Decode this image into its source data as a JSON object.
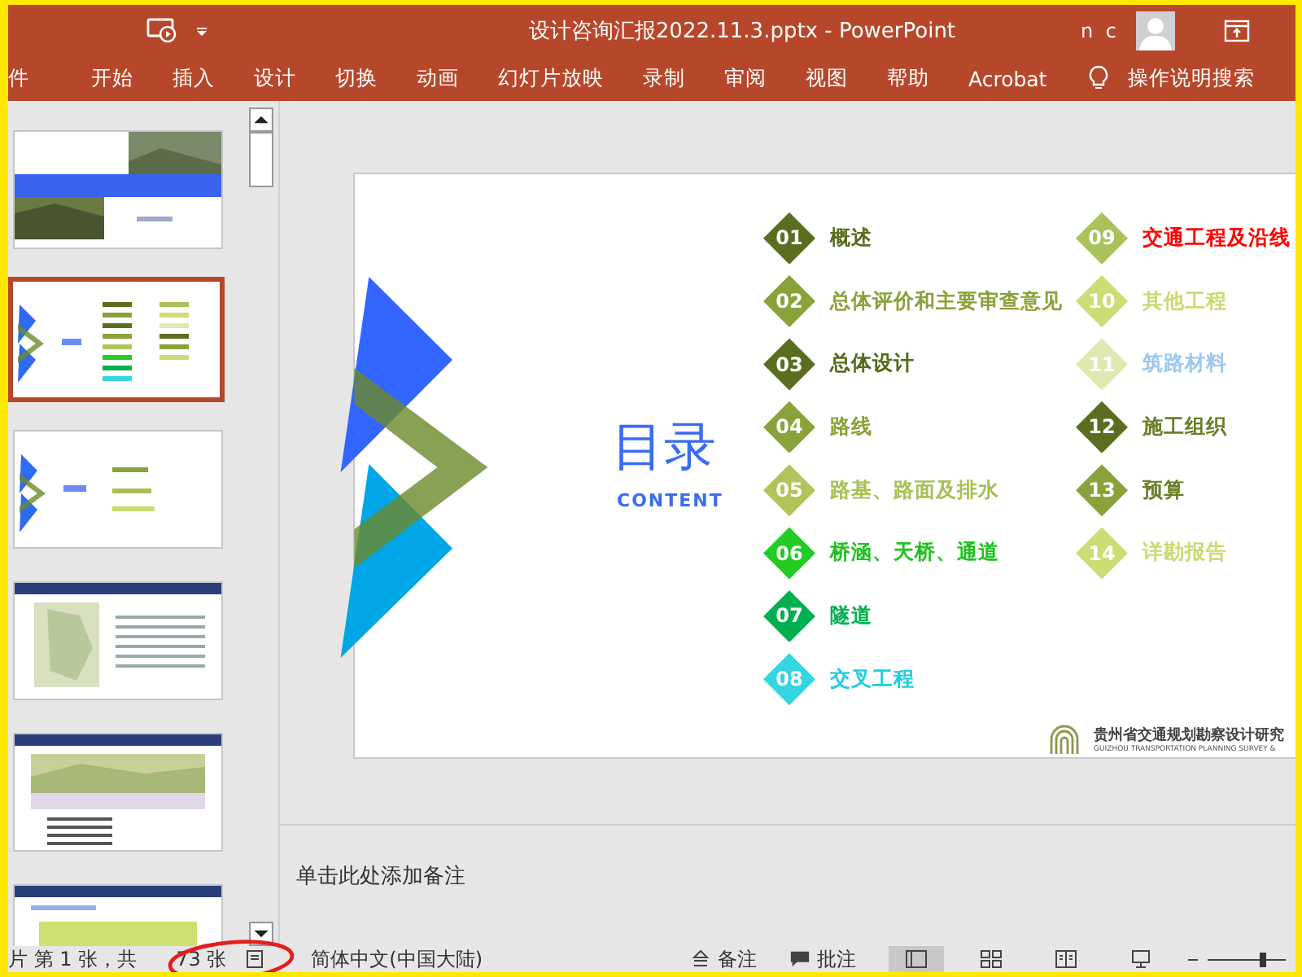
{
  "window": {
    "title": "设计咨询汇报2022.11.3.pptx  -  PowerPoint",
    "user": "n c"
  },
  "ribbon_tabs": [
    {
      "label": "件"
    },
    {
      "label": "开始"
    },
    {
      "label": "插入"
    },
    {
      "label": "设计"
    },
    {
      "label": "切换"
    },
    {
      "label": "动画"
    },
    {
      "label": "幻灯片放映"
    },
    {
      "label": "录制"
    },
    {
      "label": "审阅"
    },
    {
      "label": "视图"
    },
    {
      "label": "帮助"
    },
    {
      "label": "Acrobat"
    }
  ],
  "tell_me": "操作说明搜索",
  "thumbnails": [
    {
      "kind": "title-photo",
      "selected": false
    },
    {
      "kind": "contents",
      "selected": true
    },
    {
      "kind": "section",
      "selected": false
    },
    {
      "kind": "map-text",
      "selected": false
    },
    {
      "kind": "map-table",
      "selected": false
    },
    {
      "kind": "table",
      "selected": false
    }
  ],
  "slide": {
    "title": "目录",
    "subtitle": "CONTENT",
    "items": [
      {
        "number": "01",
        "color": "#5b6e1f",
        "label": {
          "text": "概述",
          "color": "#5a6e1e"
        }
      },
      {
        "number": "02",
        "color": "#8aa23a",
        "label": {
          "text": "总体评价和主要审查意见",
          "color": "#8aa23a"
        }
      },
      {
        "number": "03",
        "color": "#5b6e1f",
        "label": {
          "text": "总体设计",
          "color": "#556b1a"
        }
      },
      {
        "number": "04",
        "color": "#8aa23a",
        "label": {
          "text": "路线",
          "color": "#8aa23a"
        }
      },
      {
        "number": "05",
        "color": "#b0c45a",
        "label": {
          "text": "路基、路面及排水",
          "color": "#a8bf55"
        }
      },
      {
        "number": "06",
        "color": "#22cc22",
        "label": {
          "text": "桥涵、天桥、通道",
          "color": "#1fc21f"
        }
      },
      {
        "number": "07",
        "color": "#00b050",
        "label": {
          "text": "隧道",
          "color": "#00b050"
        }
      },
      {
        "number": "08",
        "color": "#33d6e0",
        "label": {
          "text": "交叉工程",
          "color": "#22ccdd"
        }
      },
      {
        "number": "09",
        "color": "#a9c25a",
        "label": {
          "text": "交通工程及沿线",
          "color": "#ff0000"
        }
      },
      {
        "number": "10",
        "color": "#cddc74",
        "label": {
          "text": "其他工程",
          "color": "#c9db70"
        }
      },
      {
        "number": "11",
        "color": "#dde9b0",
        "label": {
          "text": "筑路材料",
          "color": "#9cc8f0"
        }
      },
      {
        "number": "12",
        "color": "#5b6e1f",
        "label": {
          "text": "施工组织",
          "color": "#6b7f2a"
        }
      },
      {
        "number": "13",
        "color": "#8aa23a",
        "label": {
          "text": "预算",
          "color": "#6b7f2a"
        }
      },
      {
        "number": "14",
        "color": "#cddc74",
        "label": {
          "text": "详勘报告",
          "color": "#c9db70"
        }
      }
    ],
    "logo_name": "贵州省交通规划勘察设计研究",
    "logo_subtitle": "GUIZHOU TRANSPORTATION PLANNING SURVEY &"
  },
  "notes": {
    "placeholder": "单击此处添加备注"
  },
  "status_bar": {
    "slide_position": "片 第 1 张，共",
    "slide_total": "73 张",
    "zoom": {
      "level": 0.7
    },
    "language": "简体中文(中国大陆)",
    "notes_button": "备注",
    "comments_button": "批注",
    "views": [
      {
        "kind": "normal",
        "selected": true
      },
      {
        "kind": "sorter",
        "selected": false
      },
      {
        "kind": "reading",
        "selected": false
      },
      {
        "kind": "slideshow",
        "selected": false
      }
    ]
  }
}
